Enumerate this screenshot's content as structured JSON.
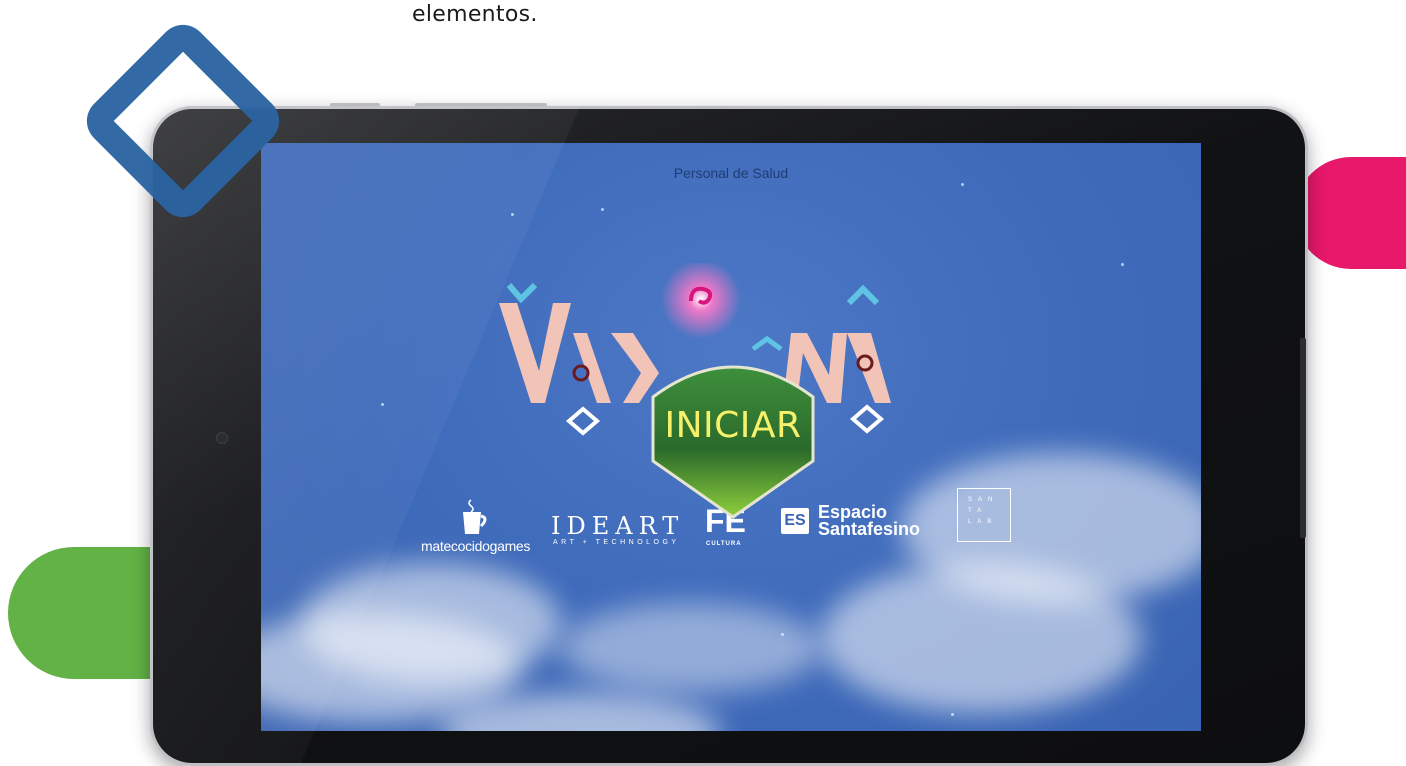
{
  "caption": "elementos.",
  "colors": {
    "pink": "#e8186b",
    "green": "#62b245",
    "blue": "#2b64a2",
    "screen": "#3f6bbb",
    "button_text": "#f7f06a"
  },
  "screen": {
    "top_title": "Personal de Salud",
    "game_logo": "VAKUNIÂ",
    "start_button": "INICIAR",
    "logos": {
      "matecocido": "matecocidogames",
      "ideart": "IDEART",
      "ideart_sub": "ART + TECHNOLOGY",
      "fe": "FE",
      "fe_sub": "CULTURA",
      "es_box": "ES",
      "espacio_line1": "Espacio",
      "espacio_line2": "Santafesino",
      "santalab": "SAN TA LAB"
    }
  }
}
